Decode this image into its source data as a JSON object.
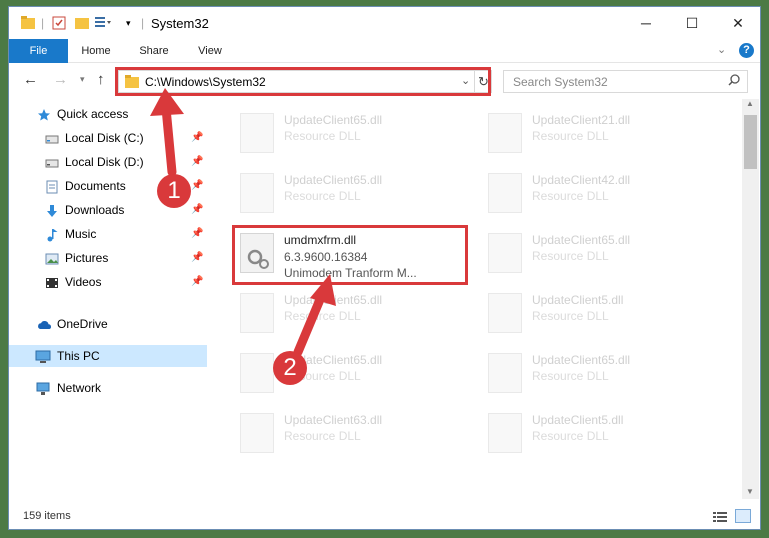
{
  "window": {
    "title": "System32"
  },
  "ribbon": {
    "tabs": [
      "File",
      "Home",
      "Share",
      "View"
    ]
  },
  "nav": {
    "address": "C:\\Windows\\System32",
    "search_placeholder": "Search System32"
  },
  "sidebar": {
    "items": [
      {
        "label": "Quick access",
        "pinned": false
      },
      {
        "label": "Local Disk (C:)",
        "pinned": true
      },
      {
        "label": "Local Disk (D:)",
        "pinned": true
      },
      {
        "label": "Documents",
        "pinned": true
      },
      {
        "label": "Downloads",
        "pinned": true
      },
      {
        "label": "Music",
        "pinned": true
      },
      {
        "label": "Pictures",
        "pinned": true
      },
      {
        "label": "Videos",
        "pinned": true
      },
      {
        "label": "OneDrive",
        "pinned": false
      },
      {
        "label": "This PC",
        "pinned": false
      },
      {
        "label": "Network",
        "pinned": false
      }
    ]
  },
  "files": {
    "left": [
      {
        "name": "UpdateClient65.dll",
        "type": "Resource DLL"
      },
      {
        "name": "UpdateClient65.dll",
        "type": "Resource DLL"
      },
      {
        "name": "UpdateClient65.dll",
        "type": "Resource DLL"
      },
      {
        "name": "UpdateClient65.dll",
        "type": "Resource DLL"
      },
      {
        "name": "UpdateClient63.dll",
        "type": "Resource DLL"
      }
    ],
    "right": [
      {
        "name": "UpdateClient21.dll",
        "type": "Resource DLL"
      },
      {
        "name": "UpdateClient42.dll",
        "type": "Resource DLL"
      },
      {
        "name": "UpdateClient65.dll",
        "type": "Resource DLL"
      },
      {
        "name": "UpdateClient5.dll",
        "type": "Resource DLL"
      },
      {
        "name": "UpdateClient65.dll",
        "type": "Resource DLL"
      },
      {
        "name": "UpdateClient5.dll",
        "type": "Resource DLL"
      }
    ],
    "selected": {
      "name": "umdmxfrm.dll",
      "version": "6.3.9600.16384",
      "description": "Unimodem Tranform M..."
    }
  },
  "status": {
    "item_count": "159 items"
  },
  "annotations": {
    "step1": "1",
    "step2": "2"
  },
  "colors": {
    "accent": "#1979ca",
    "highlight": "#d9393b",
    "selected_bg": "#cce8ff"
  }
}
